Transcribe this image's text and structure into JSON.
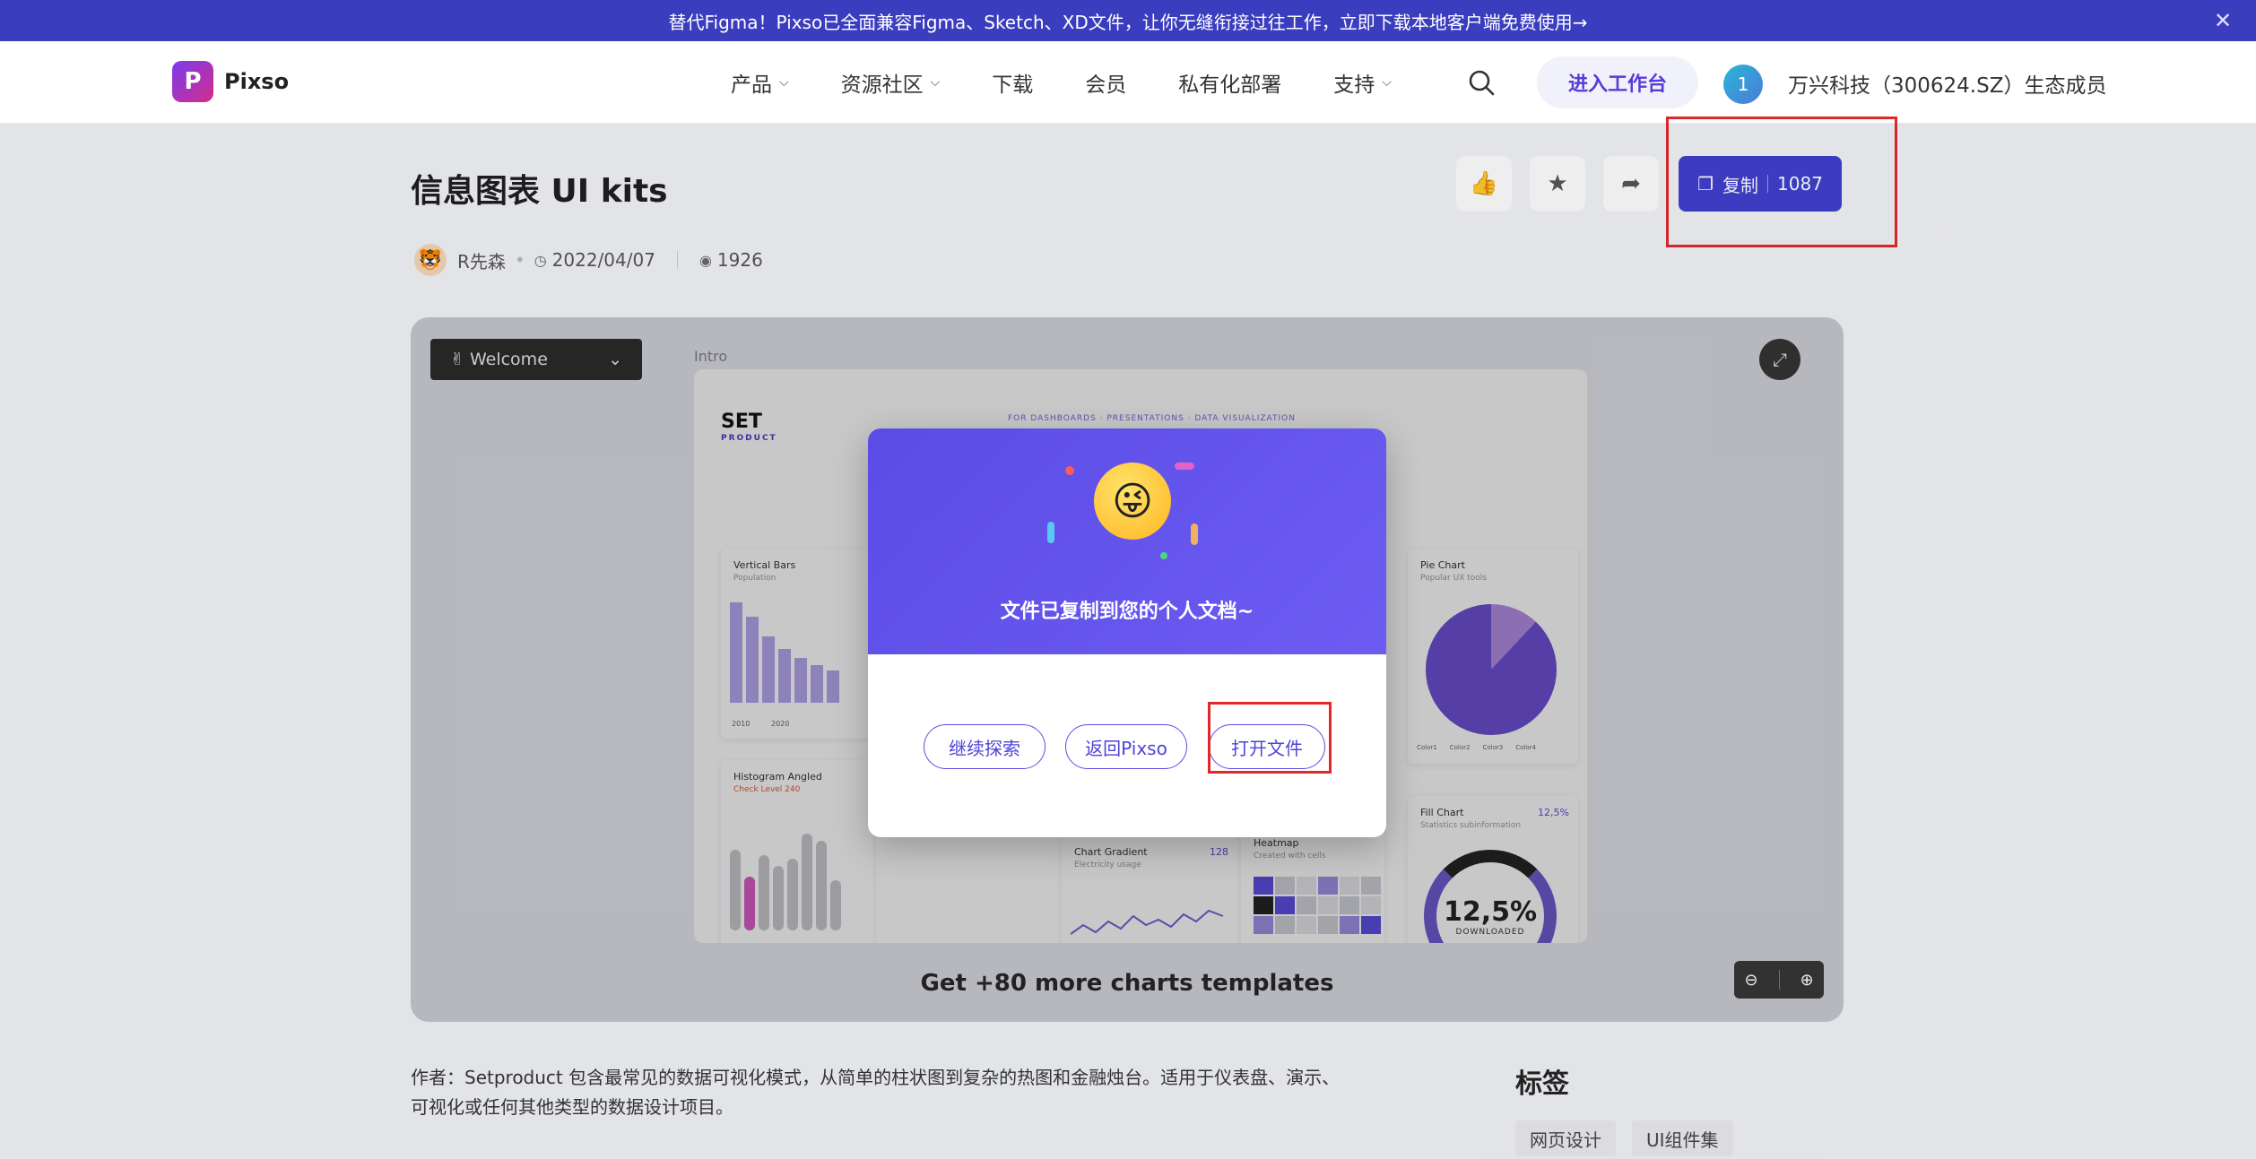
{
  "banner": {
    "text": "替代Figma！Pixso已全面兼容Figma、Sketch、XD文件，让你无缝衔接过往工作，立即下载本地客户端免费使用→",
    "close_icon": "close-icon"
  },
  "header": {
    "logo_text": "Pixso",
    "logo_glyph": "P",
    "nav": [
      {
        "label": "产品",
        "has_dropdown": true
      },
      {
        "label": "资源社区",
        "has_dropdown": true
      },
      {
        "label": "下载",
        "has_dropdown": false
      },
      {
        "label": "会员",
        "has_dropdown": false
      },
      {
        "label": "私有化部署",
        "has_dropdown": false
      },
      {
        "label": "支持",
        "has_dropdown": true
      }
    ],
    "enter_label": "进入工作台",
    "avatar_text": "1",
    "partner_text": "万兴科技（300624.SZ）生态成员"
  },
  "file": {
    "title": "信息图表 UI kits",
    "author": "R先森",
    "date": "2022/04/07",
    "views": "1926",
    "copy_label": "复制",
    "copy_count": "1087"
  },
  "preview": {
    "welcome_label": "Welcome",
    "welcome_emoji": "✌",
    "frame_label": "Intro",
    "brand": "SET",
    "brand_sub": "PRODUCT",
    "tagline": "FOR DASHBOARDS · PRESENTATIONS · DATA VISUALIZATION",
    "cards": {
      "vbars_title": "Vertical Bars",
      "vbars_sub": "Population",
      "vbars_y1": "2010",
      "vbars_y2": "2020",
      "pie_title": "Pie Chart",
      "pie_sub": "Popular UX tools",
      "pie_legend": [
        "Color1",
        "Color2",
        "Color3",
        "Color4"
      ],
      "hist_title": "Histogram Angled",
      "hist_sub": "Check Level 240",
      "grad_title": "Chart Gradient",
      "grad_sub": "Electricity usage",
      "grad_val": "128",
      "heat_title": "Heatmap",
      "heat_sub": "Created with cells",
      "fill_title": "Fill Chart",
      "fill_sub": "Statistics subinformation",
      "fill_pct": "12,5%",
      "donut_value": "12,5%",
      "donut_label": "DOWNLOADED"
    },
    "caption": "Get +80 more charts templates"
  },
  "description": "作者：Setproduct 包含最常见的数据可视化模式，从简单的柱状图到复杂的热图和金融烛台。适用于仪表盘、演示、可视化或任何其他类型的数据设计项目。",
  "tags": {
    "title": "标签",
    "items": [
      "网页设计",
      "UI组件集"
    ]
  },
  "modal": {
    "message": "文件已复制到您的个人文档~",
    "buttons": [
      "继续探索",
      "返回Pixso",
      "打开文件"
    ]
  },
  "colors": {
    "brand": "#3d3ecb",
    "banner": "#3b3dbf",
    "highlight": "#e02828"
  }
}
